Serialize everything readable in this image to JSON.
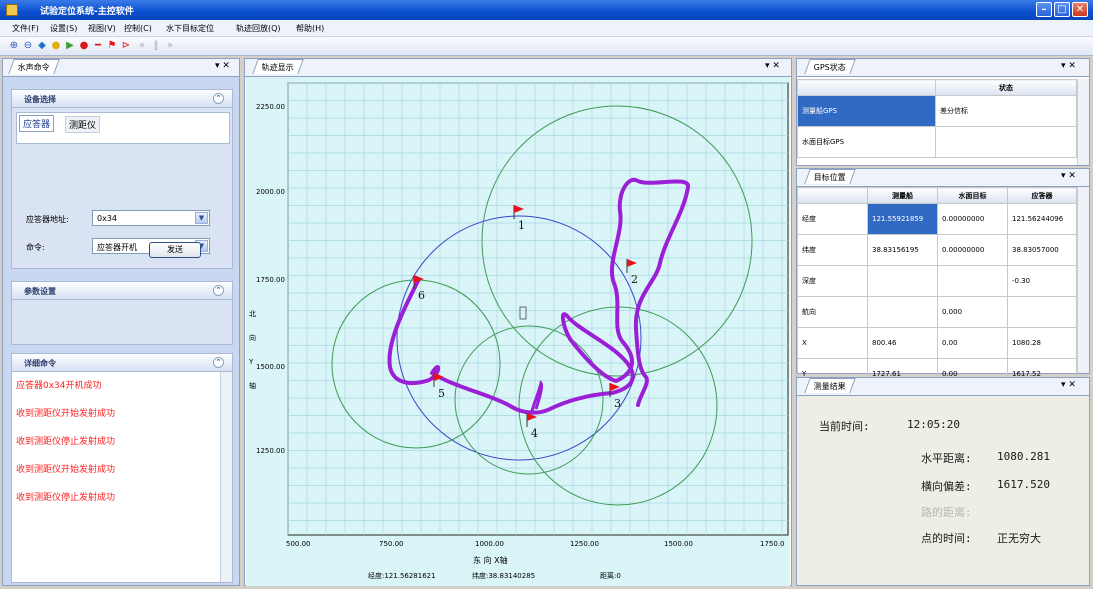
{
  "window": {
    "title": "试验定位系统-主控软件"
  },
  "menu": [
    "文件(F)",
    "设置(S)",
    "视图(V)",
    "控制(C)",
    "水下目标定位",
    "轨迹回放(Q)",
    "帮助(H)"
  ],
  "panels": {
    "left_tab": "水声命令",
    "center_tab": "轨迹显示",
    "gps_tab": "GPS状态",
    "target_tab": "目标位置",
    "result_tab": "测量结果",
    "pin": "▾ ✕"
  },
  "device": {
    "header": "设备选择",
    "tabs": [
      "应答器",
      "测距仪"
    ],
    "address_label": "应答器地址:",
    "address_value": "0x34",
    "command_label": "命令:",
    "command_value": "应答器开机",
    "send_label": "发送"
  },
  "params": {
    "header": "参数设置"
  },
  "detail": {
    "header": "详细命令",
    "lines": [
      "应答器0x34开机成功",
      "收到测距仪开始发射成功",
      "收到测距仪停止发射成功",
      "收到测距仪开始发射成功",
      "收到测距仪停止发射成功"
    ]
  },
  "plot": {
    "y_ticks": [
      "2250.00",
      "2000.00",
      "1750.00",
      "1500.00",
      "1250.00"
    ],
    "x_ticks": [
      "500.00",
      "750.00",
      "1000.00",
      "1250.00",
      "1500.00",
      "1750.0"
    ],
    "y_axis_label": "北 向 Y 轴",
    "x_axis_label": "东  向  X轴",
    "markers": [
      "1",
      "2",
      "3",
      "4",
      "5",
      "6"
    ],
    "status": {
      "lon": "经度:121.56281621",
      "lat": "纬度:38.83140285",
      "dist": "距离:0"
    }
  },
  "gps": {
    "headers": [
      "",
      "状态"
    ],
    "rows": [
      [
        "测量船GPS",
        "差分信标"
      ],
      [
        "水面目标GPS",
        ""
      ]
    ]
  },
  "target": {
    "headers": [
      "",
      "测量船",
      "水面目标",
      "应答器"
    ],
    "rows": [
      [
        "经度",
        "121.55921859",
        "0.00000000",
        "121.56244096"
      ],
      [
        "纬度",
        "38.83156195",
        "0.00000000",
        "38.83057000"
      ],
      [
        "深度",
        "",
        "",
        "-0.30"
      ],
      [
        "航向",
        "",
        "0.000",
        ""
      ],
      [
        "X",
        "800.46",
        "0.00",
        "1080.28"
      ],
      [
        "Y",
        "1727.61",
        "0.00",
        "1617.52"
      ]
    ]
  },
  "result": {
    "time_label": "当前时间:",
    "time_value": "12:05:20",
    "h_label": "水平距离:",
    "h_value": "1080.281",
    "v_label": "横向偏差:",
    "v_value": "1617.520",
    "path_label": "路的距离:",
    "pt_label": "点的时间:",
    "pt_value": "正无穷大"
  },
  "colors": {
    "track": "#9b1fd6",
    "circle_blue": "#3b45c9",
    "circle_green": "#3f9a55",
    "flag": "#e8121a",
    "plot_bg": "#d9f5f7",
    "grid": "#a8d7e3"
  }
}
